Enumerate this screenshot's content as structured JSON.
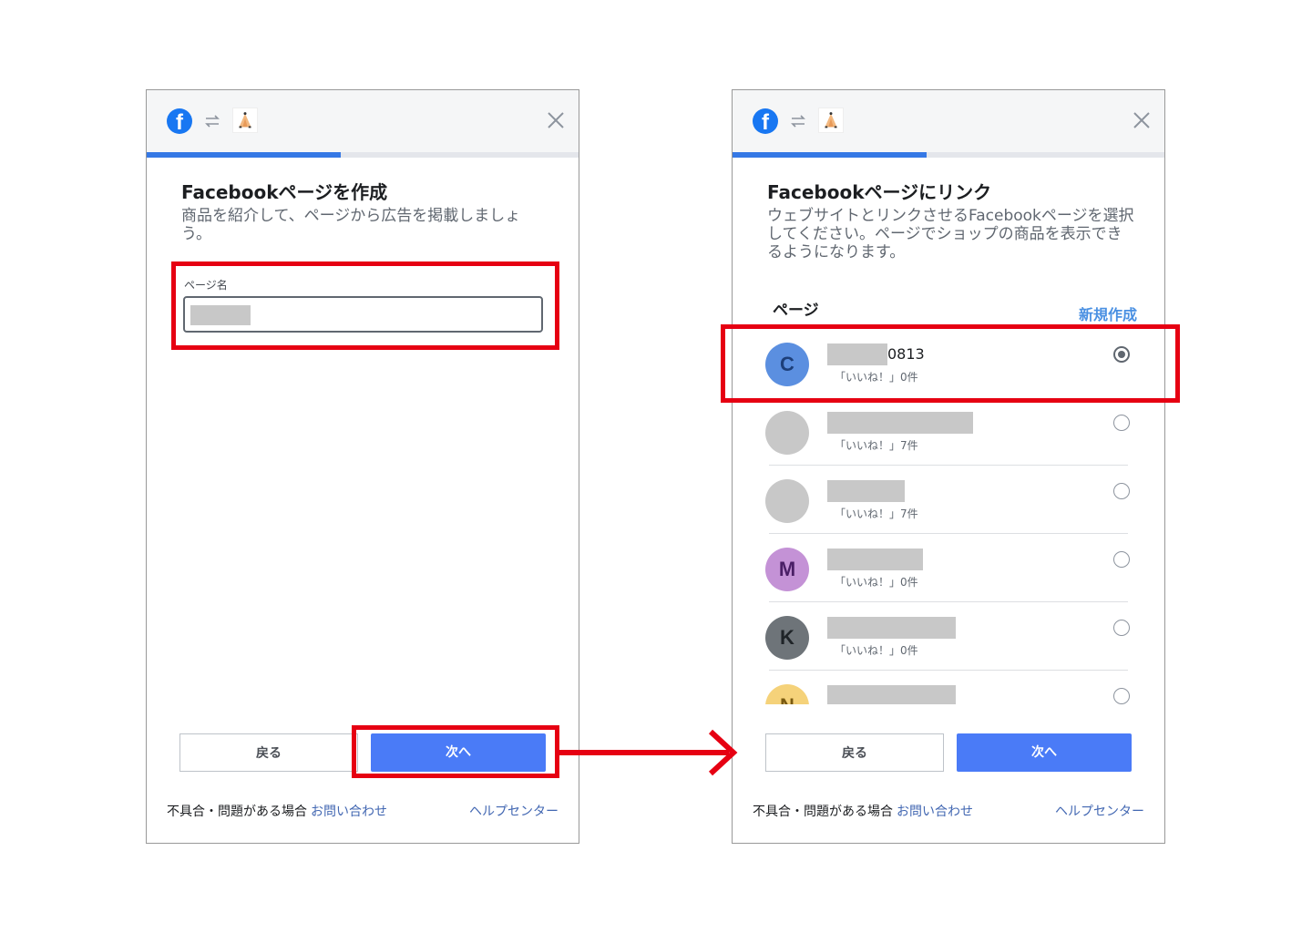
{
  "common": {
    "brand_letter": "f",
    "back_label": "戻る",
    "next_label": "次へ",
    "footer_text": "不具合・問題がある場合",
    "contact_link": "お問い合わせ",
    "help_link": "ヘルプセンター"
  },
  "left_dialog": {
    "progress_percent": 45,
    "title": "Facebookページを作成",
    "subtitle": "商品を紹介して、ページから広告を掲載しましょう。",
    "field_label": "ページ名",
    "field_value": ""
  },
  "right_dialog": {
    "progress_percent": 45,
    "title": "Facebookページにリンク",
    "subtitle": "ウェブサイトとリンクさせるFacebookページを選択してください。ページでショップの商品を表示できるようになります。",
    "section_label": "ページ",
    "create_link": "新規作成",
    "pages": [
      {
        "initial": "C",
        "name": "0813",
        "likes": "「いいね！」0件",
        "selected": true,
        "avatar_color": "#5b8fe0",
        "text_color": "#1d3f7a"
      },
      {
        "initial": "",
        "name": "",
        "likes": "「いいね！」7件",
        "selected": false,
        "avatar_color": "#c8c8c8",
        "text_color": "#c8c8c8"
      },
      {
        "initial": "",
        "name": "",
        "likes": "「いいね！」7件",
        "selected": false,
        "avatar_color": "#c8c8c8",
        "text_color": "#c8c8c8"
      },
      {
        "initial": "M",
        "name": "",
        "likes": "「いいね！」0件",
        "selected": false,
        "avatar_color": "#c492d6",
        "text_color": "#4a1f66"
      },
      {
        "initial": "K",
        "name": "",
        "likes": "「いいね！」0件",
        "selected": false,
        "avatar_color": "#6e7479",
        "text_color": "#1f2428"
      },
      {
        "initial": "N",
        "name": "",
        "likes": "",
        "selected": false,
        "avatar_color": "#f5d27a",
        "text_color": "#7a5a10"
      }
    ]
  },
  "colors": {
    "annotation": "#e60012",
    "primary_button": "#4a7bf7",
    "progress": "#3578e5",
    "link": "#4267b2"
  }
}
